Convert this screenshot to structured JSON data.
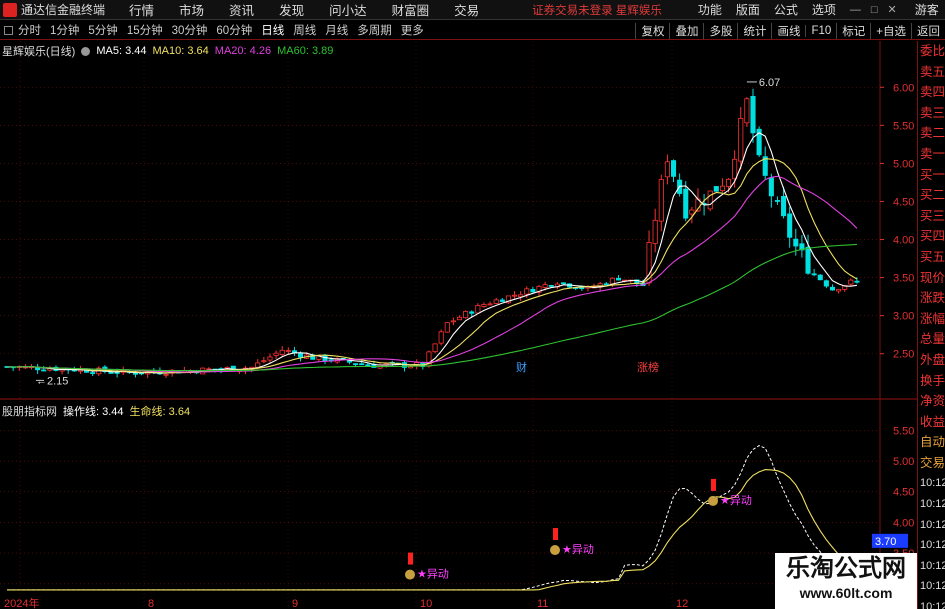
{
  "menubar": {
    "app_title": "通达信金融终端",
    "items": [
      "行情",
      "市场",
      "资讯",
      "发现",
      "问小达",
      "财富圈",
      "交易"
    ],
    "status": "证券交易未登录  星辉娱乐",
    "right_items": [
      "功能",
      "版面",
      "公式",
      "选项"
    ],
    "guest": "游客"
  },
  "periodbar": {
    "tabs": [
      "分时",
      "1分钟",
      "5分钟",
      "15分钟",
      "30分钟",
      "60分钟",
      "日线",
      "周线",
      "月线",
      "多周期",
      "更多"
    ],
    "active": "日线",
    "right_tabs": [
      "复权",
      "叠加",
      "多股",
      "统计",
      "画线",
      "F10",
      "标记",
      "+自选",
      "返回"
    ]
  },
  "main_chart": {
    "stock_label": "星辉娱乐(日线)",
    "ma": [
      {
        "name": "MA5",
        "value": "3.44",
        "color": "#ffffff"
      },
      {
        "name": "MA10",
        "value": "3.64",
        "color": "#f0e060"
      },
      {
        "name": "MA20",
        "value": "4.26",
        "color": "#e040e0"
      },
      {
        "name": "MA60",
        "value": "3.89",
        "color": "#30c030"
      }
    ],
    "y_ticks": [
      "6.00",
      "5.50",
      "5.00",
      "4.50",
      "4.00",
      "3.50",
      "3.00",
      "2.50"
    ],
    "high_label": "6.07",
    "low_label": "2.15",
    "markers": [
      {
        "text": "财",
        "color": "#40a0ff"
      },
      {
        "text": "涨榜",
        "color": "#ff4040"
      }
    ]
  },
  "right_strip": [
    "委比",
    "卖五",
    "卖四",
    "卖三",
    "卖二",
    "卖一",
    "买一",
    "买二",
    "买三",
    "买四",
    "买五",
    "现价",
    "涨跌",
    "涨幅",
    "总量",
    "外盘",
    "换手",
    "净资",
    "收益",
    "自动",
    "交易",
    "10:12",
    "10:12",
    "10:12",
    "10:12",
    "10:12",
    "10:12",
    "10:12"
  ],
  "indicator": {
    "name": "股朋指标网",
    "lines": [
      {
        "name": "操作线",
        "value": "3.44",
        "color": "#ffffff"
      },
      {
        "name": "生命线",
        "value": "3.64",
        "color": "#f0e060"
      }
    ],
    "y_ticks": [
      "5.50",
      "5.00",
      "4.50",
      "4.00",
      "3.50",
      "3.00"
    ],
    "current_value": "3.70",
    "signal_text": "★异动"
  },
  "x_axis": {
    "labels": [
      "2024年",
      "8",
      "9",
      "10",
      "11",
      "12"
    ]
  },
  "watermark": {
    "line1": "乐淘公式网",
    "line2": "www.60lt.com"
  },
  "colors": {
    "up": "#ff3232",
    "down": "#00e0e0",
    "grid": "#7a1010",
    "axis_text": "#e03030"
  },
  "chart_data": {
    "type": "line",
    "title": "星辉娱乐(日线)",
    "x": [
      "2024-07",
      "2024-08",
      "2024-09",
      "2024-10",
      "2024-11",
      "2024-12"
    ],
    "ylim": [
      2.15,
      6.2
    ],
    "series": [
      {
        "name": "MA5",
        "values": [
          2.3,
          2.35,
          2.45,
          3.3,
          3.45,
          4.9,
          3.44
        ]
      },
      {
        "name": "MA10",
        "values": [
          2.3,
          2.33,
          2.4,
          3.1,
          3.4,
          4.8,
          3.64
        ]
      },
      {
        "name": "MA20",
        "values": [
          2.32,
          2.32,
          2.38,
          2.9,
          3.3,
          4.7,
          4.26
        ]
      },
      {
        "name": "MA60",
        "values": [
          2.5,
          2.4,
          2.35,
          2.55,
          2.95,
          3.7,
          3.89
        ]
      }
    ]
  }
}
